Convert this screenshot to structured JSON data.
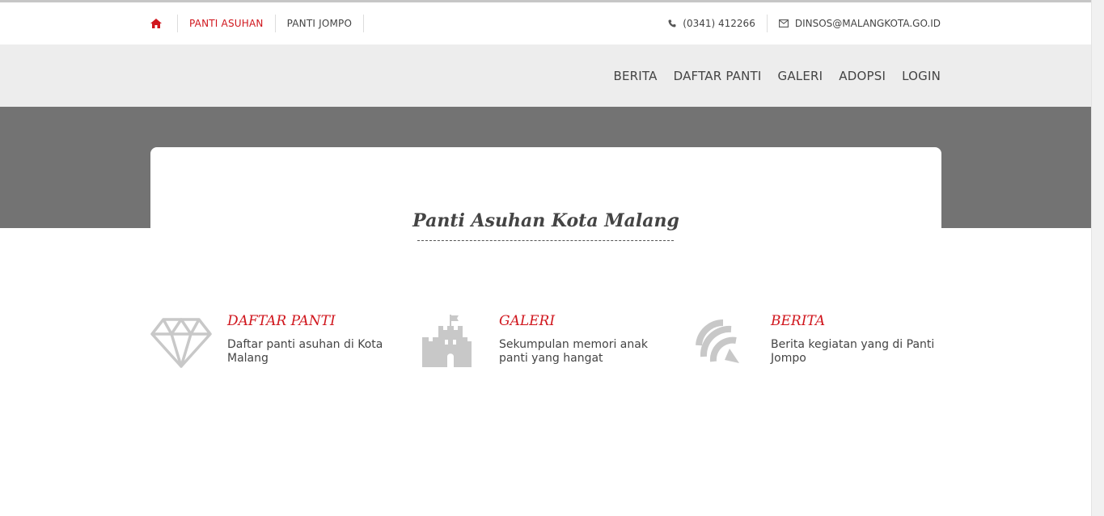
{
  "topbar": {
    "links": [
      {
        "label": "PANTI ASUHAN",
        "active": true
      },
      {
        "label": "PANTI JOMPO",
        "active": false
      }
    ],
    "phone": "(0341) 412266",
    "email": "DINSOS@MALANGKOTA.GO.ID",
    "icons": {
      "home": "home-icon",
      "phone": "phone-icon",
      "email": "envelope-icon"
    }
  },
  "nav": {
    "items": [
      "BERITA",
      "DAFTAR PANTI",
      "GALERI",
      "ADOPSI",
      "LOGIN"
    ]
  },
  "hero": {
    "title": "Panti Asuhan Kota Malang"
  },
  "features": [
    {
      "icon": "diamond-icon",
      "title": "DAFTAR PANTI",
      "desc": "Daftar panti asuhan di Kota Malang"
    },
    {
      "icon": "castle-icon",
      "title": "GALERI",
      "desc": "Sekumpulan memori anak panti yang hangat"
    },
    {
      "icon": "rss-icon",
      "title": "BERITA",
      "desc": "Berita kegiatan yang di Panti Jompo"
    }
  ],
  "colors": {
    "accent": "#d0161d",
    "hero_bg": "#737373",
    "nav_bg": "#ededed",
    "icon": "#c8c8c8"
  }
}
